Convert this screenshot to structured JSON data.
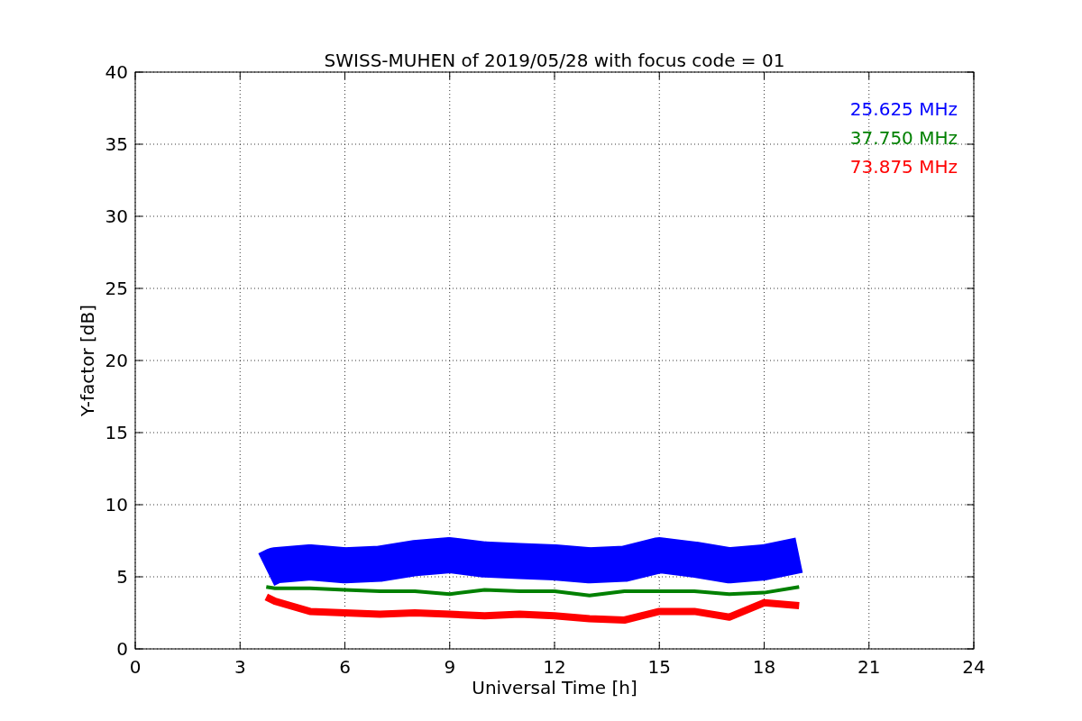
{
  "chart_data": {
    "type": "line",
    "title": "SWISS-MUHEN of 2019/05/28 with focus code = 01",
    "xlabel": "Universal Time [h]",
    "ylabel": "Y-factor [dB]",
    "x": [
      3.75,
      4,
      5,
      6,
      7,
      8,
      9,
      10,
      11,
      12,
      13,
      14,
      15,
      16,
      17,
      18,
      19
    ],
    "series": [
      {
        "name": "25.625 MHz",
        "color": "#0000ff",
        "values": [
          5.5,
          5.8,
          6,
          5.8,
          5.9,
          6.3,
          6.5,
          6.2,
          6.1,
          6,
          5.8,
          5.9,
          6.5,
          6.2,
          5.8,
          6,
          6.5
        ]
      },
      {
        "name": "37.750 MHz",
        "color": "#008000",
        "values": [
          4.3,
          4.2,
          4.2,
          4.1,
          4.0,
          4.0,
          3.8,
          4.1,
          4.0,
          4.0,
          3.7,
          4.0,
          4.0,
          4.0,
          3.8,
          3.9,
          4.3
        ]
      },
      {
        "name": "73.875 MHz",
        "color": "#ff0000",
        "values": [
          3.6,
          3.3,
          2.6,
          2.5,
          2.4,
          2.5,
          2.4,
          2.3,
          2.4,
          2.3,
          2.1,
          2.0,
          2.6,
          2.6,
          2.2,
          3.2,
          3.0
        ]
      }
    ],
    "xlim": [
      0,
      24
    ],
    "ylim": [
      0,
      40
    ],
    "xticks": [
      0,
      3,
      6,
      9,
      12,
      15,
      18,
      21,
      24
    ],
    "yticks": [
      0,
      5,
      10,
      15,
      20,
      25,
      30,
      35,
      40
    ],
    "grid": true
  }
}
